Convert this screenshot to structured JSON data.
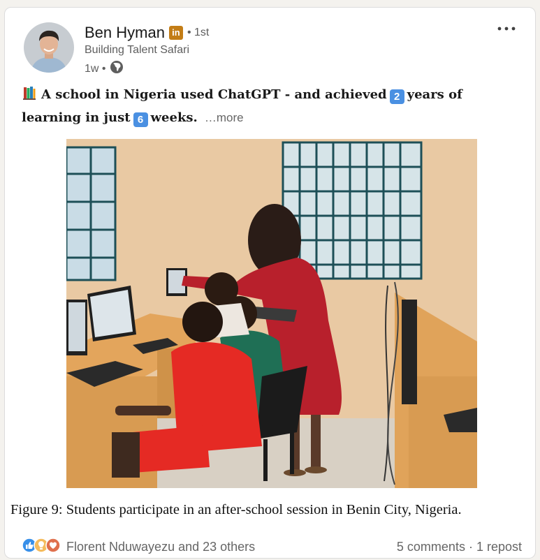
{
  "post": {
    "author": {
      "name": "Ben Hyman",
      "degree": "• 1st",
      "headline": "Building Talent Safari",
      "time": "1w •"
    },
    "menu_label": "•••",
    "text": {
      "part1": "A school in Nigeria used ChatGPT - and achieved",
      "num1": "2",
      "part2": "years of learning in just",
      "num2": "6",
      "part3": "weeks.",
      "see_more": "…more"
    },
    "image": {
      "caption": "Figure 9: Students participate in an after-school session in Benin City, Nigeria."
    },
    "social": {
      "reactions_text": "Florent Nduwayezu and 23 others",
      "comments": "5 comments",
      "separator": " · ",
      "reposts": "1 repost"
    }
  },
  "colors": {
    "badge": "#c37d16",
    "number_emoji": "#4a90e2",
    "wall": "#e9c9a3",
    "desk": "#e3a55c",
    "red_shirt": "#e52a24",
    "dress": "#b8202c",
    "green_shirt": "#1f6f55"
  },
  "icons": [
    "linkedin-badge-icon",
    "globe-icon",
    "more-options-icon",
    "books-emoji-icon",
    "like-reaction-icon",
    "insightful-reaction-icon",
    "love-reaction-icon"
  ]
}
